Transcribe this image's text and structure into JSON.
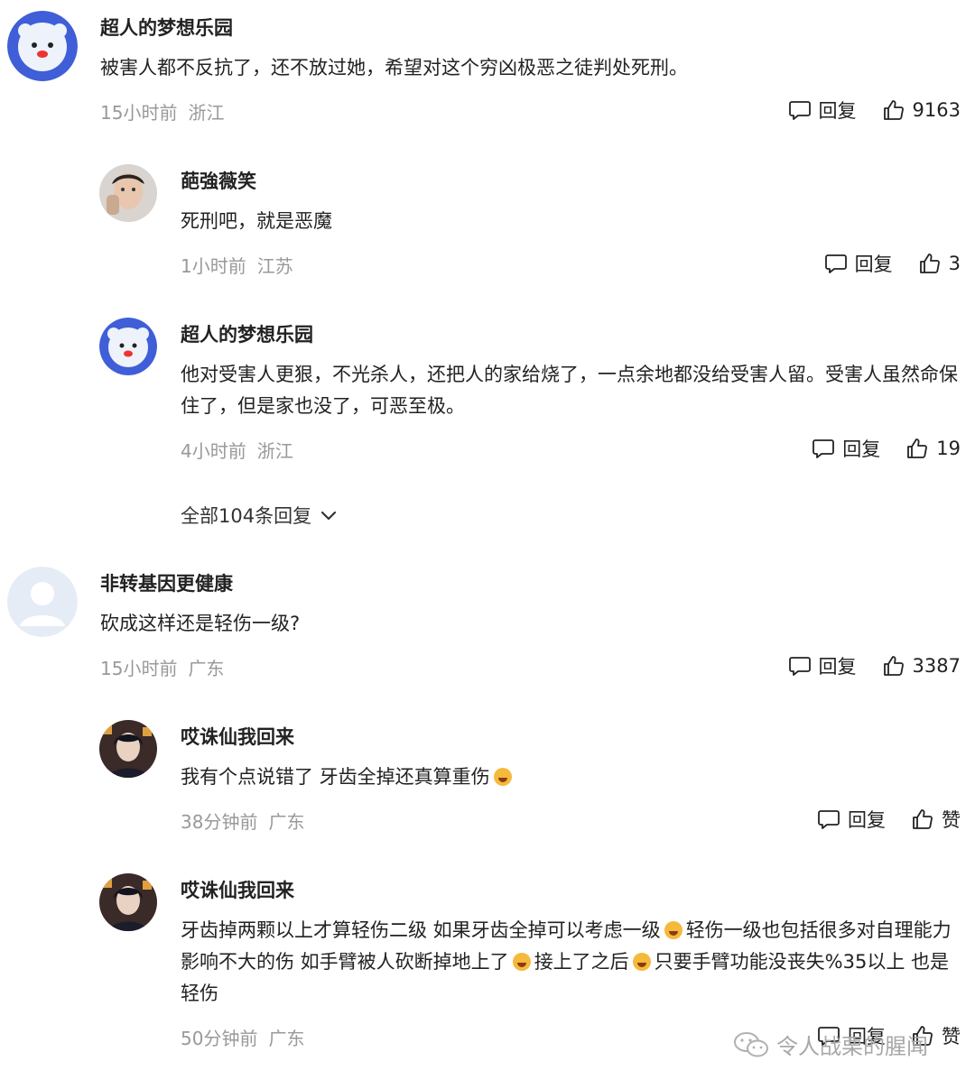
{
  "actions": {
    "reply_label": "回复"
  },
  "comments": [
    {
      "username": "超人的梦想乐园",
      "text": "被害人都不反抗了，还不放过她，希望对这个穷凶极恶之徒判处死刑。",
      "time": "15小时前",
      "region": "浙江",
      "likes": "9163",
      "replies": [
        {
          "username": "葩強薇笑",
          "text": "死刑吧，就是恶魔",
          "time": "1小时前",
          "region": "江苏",
          "likes": "3"
        },
        {
          "username": "超人的梦想乐园",
          "text": "他对受害人更狠，不光杀人，还把人的家给烧了，一点余地都没给受害人留。受害人虽然命保住了，但是家也没了，可恶至极。",
          "time": "4小时前",
          "region": "浙江",
          "likes": "19"
        }
      ],
      "expand_label": "全部104条回复"
    },
    {
      "username": "非转基因更健康",
      "text": "砍成这样还是轻伤一级?",
      "time": "15小时前",
      "region": "广东",
      "likes": "3387",
      "replies": [
        {
          "username": "哎诛仙我回来",
          "text_part1": "我有个点说错了 牙齿全掉还真算重伤",
          "time": "38分钟前",
          "region": "广东",
          "likes": "赞"
        },
        {
          "username": "哎诛仙我回来",
          "text_part1": "牙齿掉两颗以上才算轻伤二级 如果牙齿全掉可以考虑一级",
          "text_part2": "轻伤一级也包括很多对自理能力 影响不大的伤 如手臂被人砍断掉地上了",
          "text_part3": "接上了之后",
          "text_part4": "只要手臂功能没丧失%35以上 也是轻伤",
          "time": "50分钟前",
          "region": "广东",
          "likes": "赞"
        }
      ]
    }
  ],
  "watermark": {
    "text": "令人战栗的腥闻"
  },
  "icons": {
    "reply": "speech-bubble-icon",
    "like": "thumbs-up-icon",
    "expand": "chevron-down-icon",
    "watermark": "wechat-icon"
  },
  "colors": {
    "meta_gray": "#999999",
    "text": "#222222"
  }
}
